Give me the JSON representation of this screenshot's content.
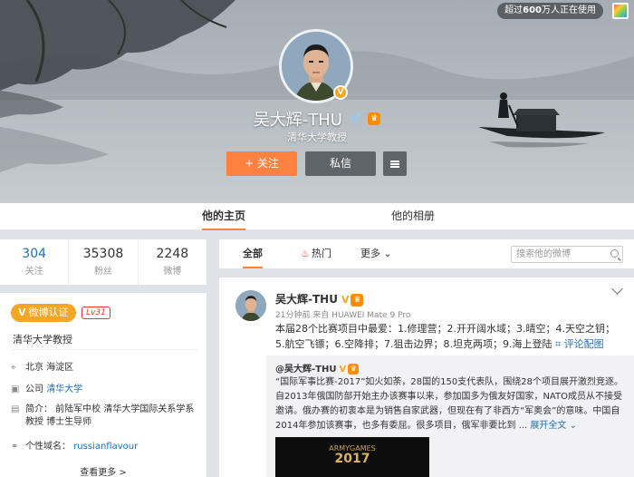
{
  "cover": {
    "online_badge_prefix": "超过",
    "online_badge_count": "600",
    "online_badge_suffix": "万人正在使用"
  },
  "profile": {
    "name": "吴大辉-THU",
    "intro": "清华大学教授",
    "follow_label": "+ 关注",
    "message_label": "私信"
  },
  "tabs": [
    {
      "label": "他的主页",
      "active": true
    },
    {
      "label": "他的相册",
      "active": false
    }
  ],
  "stats": [
    {
      "value": "304",
      "label": "关注"
    },
    {
      "value": "35308",
      "label": "粉丝"
    },
    {
      "value": "2248",
      "label": "微博"
    }
  ],
  "card": {
    "verify_label": "微博认证",
    "level_label": "Lv31",
    "intro": "清华大学教授",
    "location": "北京 海淀区",
    "company_prefix": "公司",
    "company": "清华大学",
    "bio": "简介： 前陆军中校 清华大学国际关系学系教授 博士生导师",
    "domain_label": "个性域名：",
    "domain": "russianflavour",
    "see_more": "查看更多 >"
  },
  "filters": {
    "all": "全部",
    "hot": "热门",
    "more": "更多",
    "search_placeholder": "搜索他的微博"
  },
  "post": {
    "author": "吴大辉-THU",
    "meta": "21分钟前 来自 HUAWEI Mate 9 Pro",
    "text": "本届28个比赛项目中最爱：1.修理营；2.开开阔水域；3.晴空；4.天空之钥；5.航空飞镖；6.空降排；7.狙击边界；8.坦克两项；9.海上登陆",
    "map_link": "评论配图",
    "repost": {
      "author": "@吴大辉-THU",
      "text": "“国际军事比赛-2017”如火如荼，28国的150支代表队，围绕28个项目展开激烈竞逐。自2013年俄国防部开始主办该赛事以来，参加国多为俄友好国家，NATO成员从不接受邀请。俄办赛的初衷本是为销售自家武器，但现在有了非西方“军奥会”的意味。中国自2014年参加该赛事，也多有委屈。很多项目，俄军非要比到 ...",
      "expand": "展开全文",
      "image_caption_top": "ARMYGAMES",
      "image_caption_year": "2017"
    }
  }
}
